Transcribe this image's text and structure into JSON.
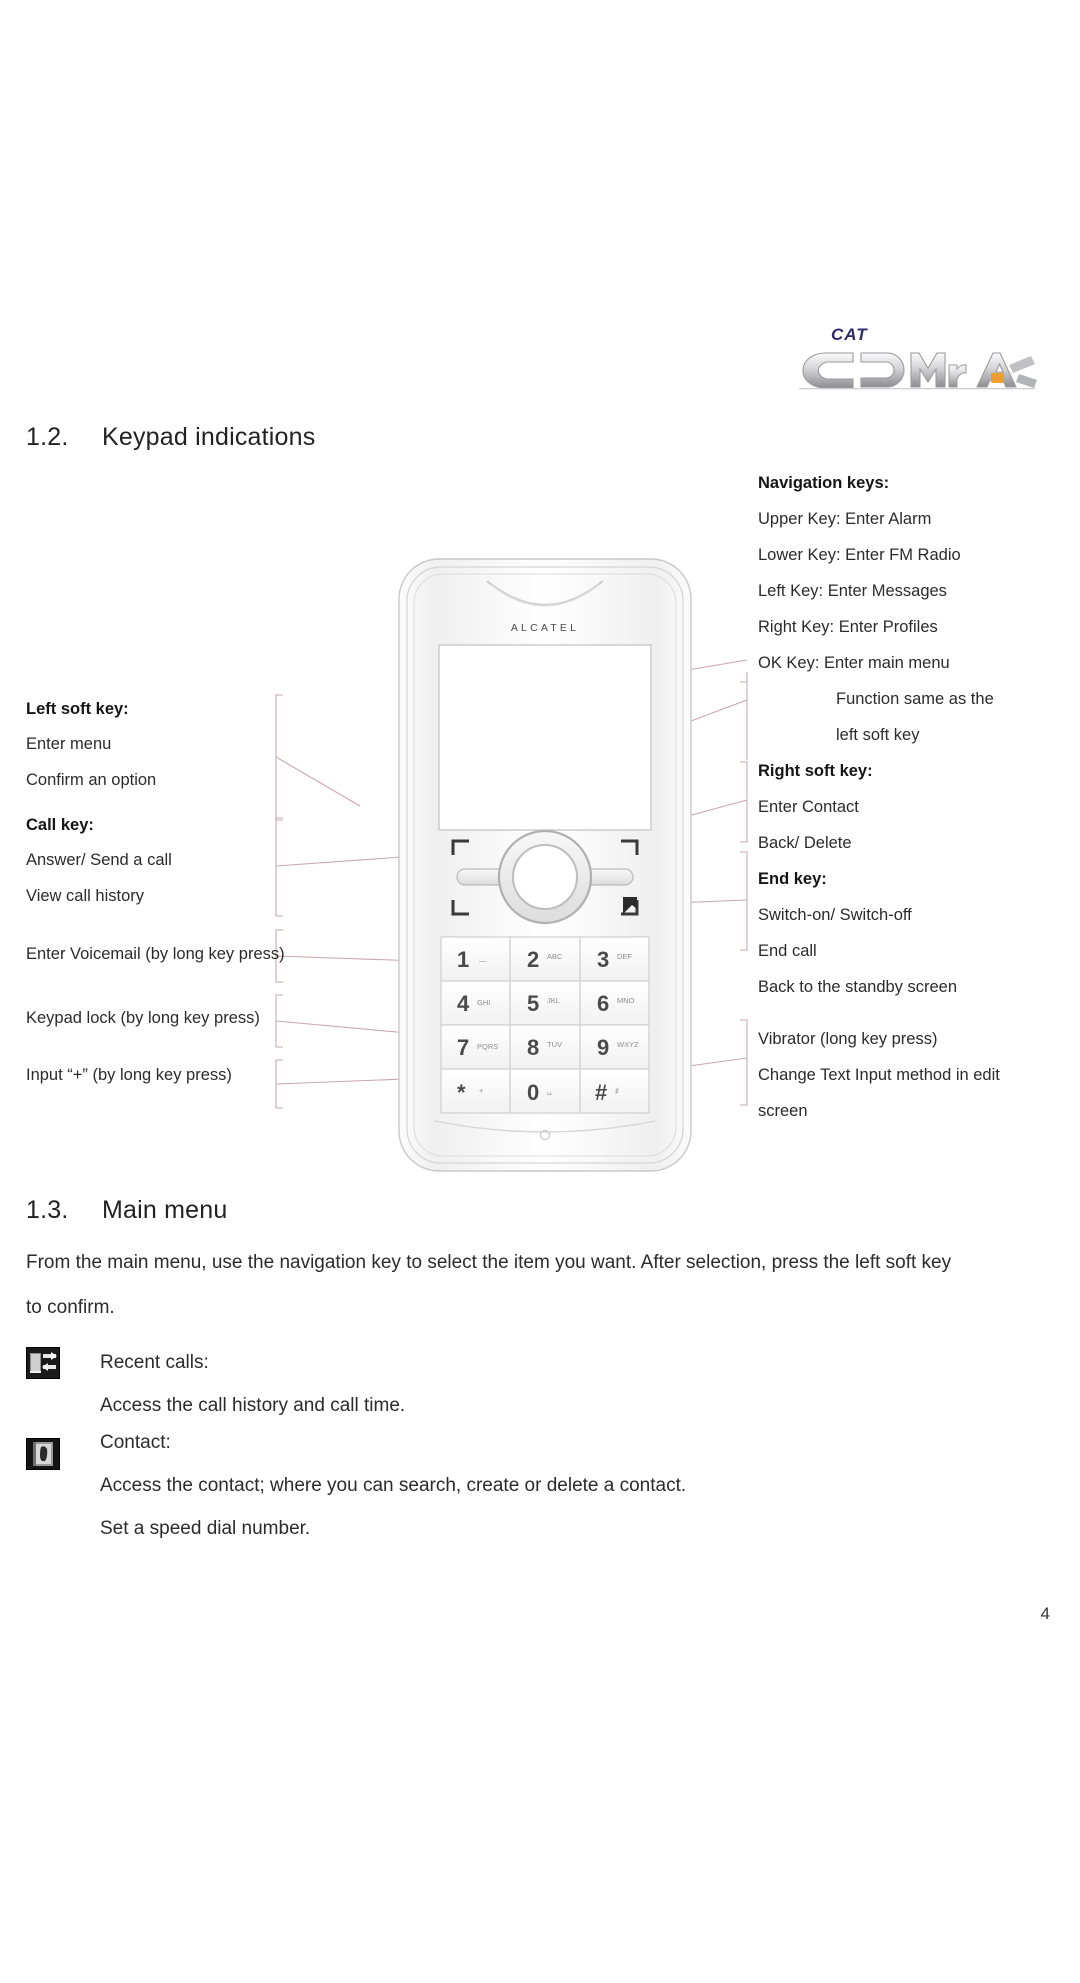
{
  "document": {
    "page_number": "4",
    "logo": {
      "top_text": "CAT",
      "main_text": "CDMA"
    },
    "phone": {
      "brand": "ALCATEL"
    }
  },
  "sections": {
    "keypad": {
      "number": "1.2.",
      "title": "Keypad indications"
    },
    "main_menu": {
      "number": "1.3.",
      "title": "Main menu"
    }
  },
  "annotations": {
    "left": {
      "left_soft_key": {
        "heading": "Left soft key:",
        "lines": [
          "Enter menu",
          "Confirm an option"
        ]
      },
      "call_key": {
        "heading": "Call key:",
        "lines": [
          "Answer/ Send a call",
          "View call history"
        ]
      },
      "voicemail": "Enter Voicemail (by long key press)",
      "keypad_lock": "Keypad lock (by long key press)",
      "input_plus": "Input “+” (by long key press)"
    },
    "right": {
      "navigation_keys": {
        "heading": "Navigation keys:",
        "lines": [
          "Upper Key: Enter Alarm",
          "Lower Key: Enter FM Radio",
          "Left Key: Enter Messages",
          "Right Key: Enter Profiles",
          "OK Key:   Enter main menu"
        ],
        "indented_lines": [
          "Function same as the",
          "left soft key"
        ]
      },
      "right_soft_key": {
        "heading": "Right soft key:",
        "lines": [
          "Enter Contact",
          "Back/ Delete"
        ]
      },
      "end_key": {
        "heading": "End key:",
        "lines": [
          "Switch-on/ Switch-off",
          "End call",
          "Back to the standby screen"
        ]
      },
      "vibrator": "Vibrator (long key press)",
      "text_input": "Change Text Input method in edit",
      "text_input_cont": "screen"
    }
  },
  "main_menu": {
    "intro_line_1": "From the main menu, use the navigation key to select the item you want. After selection, press the left soft key",
    "intro_line_2": "to confirm.",
    "items": [
      {
        "icon": "recent-calls-icon",
        "title": "Recent calls:",
        "descriptions": [
          "Access the call history and call time."
        ]
      },
      {
        "icon": "contact-icon",
        "title": "Contact:",
        "descriptions": [
          "Access the contact; where you can search, create or delete a contact.",
          "Set a speed dial number."
        ]
      }
    ]
  },
  "keypad_layout": {
    "rows": [
      [
        "1",
        "2",
        "3"
      ],
      [
        "4",
        "5",
        "6"
      ],
      [
        "7",
        "8",
        "9"
      ],
      [
        "*",
        "0",
        "#"
      ]
    ]
  }
}
